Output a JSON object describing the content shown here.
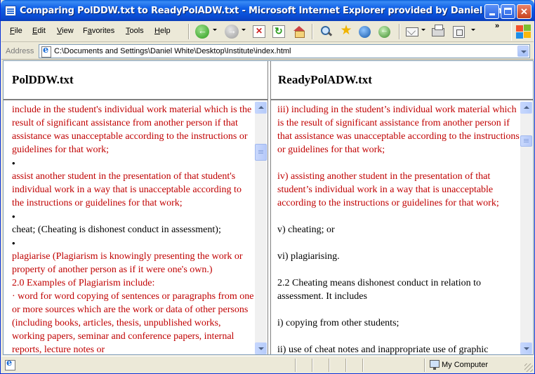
{
  "window": {
    "title": "Comparing PolDDW.txt to ReadyPolADW.txt - Microsoft Internet Explorer provided by Daniel White"
  },
  "menu": {
    "items": [
      {
        "label": "File",
        "key": "F"
      },
      {
        "label": "Edit",
        "key": "E"
      },
      {
        "label": "View",
        "key": "V"
      },
      {
        "label": "Favorites",
        "key": "a"
      },
      {
        "label": "Tools",
        "key": "T"
      },
      {
        "label": "Help",
        "key": "H"
      }
    ]
  },
  "toolbar": {
    "icons": [
      "back-icon",
      "forward-icon",
      "stop-icon",
      "refresh-icon",
      "home-icon",
      "search-icon",
      "favorites-icon",
      "media-icon",
      "history-icon",
      "mail-icon",
      "print-icon",
      "edit-icon"
    ],
    "overflow": "»"
  },
  "address": {
    "label": "Address",
    "value": "C:\\Documents and Settings\\Daniel White\\Desktop\\Institute\\index.html"
  },
  "left_frame": {
    "title": "PolDDW.txt",
    "lines": [
      {
        "text": "include in the student's individual work material which is the result of significant assistance from another person if that assistance was unacceptable according to the instructions or guidelines for that work;",
        "color": "red"
      },
      {
        "text": "•",
        "color": "black",
        "bullet": true
      },
      {
        "text": "assist another student in the presentation of that student's individual work in a way that is unacceptable according to the instructions or guidelines for that work;",
        "color": "red"
      },
      {
        "text": "•",
        "color": "black",
        "bullet": true
      },
      {
        "text": "cheat; (Cheating is dishonest conduct in assessment);",
        "color": "black"
      },
      {
        "text": "•",
        "color": "black",
        "bullet": true
      },
      {
        "text": "plagiarise (Plagiarism is knowingly presenting the work or property of another person as if it were one's own.)",
        "color": "red"
      },
      {
        "text": "2.0 Examples of Plagiarism include:",
        "color": "red"
      },
      {
        "text": "· word for word copying of sentences or paragraphs from one or more sources which are the work or data of other persons (including books, articles, thesis, unpublished works, working papers, seminar and conference papers, internal reports, lecture notes or",
        "color": "red"
      }
    ]
  },
  "right_frame": {
    "title": "ReadyPolADW.txt",
    "lines": [
      {
        "text": "iii) including in the student’s individual work material which is the result of significant assistance from another person if that assistance was unacceptable according to the instructions or guidelines for that work;",
        "color": "red"
      },
      {
        "text": "",
        "color": "black",
        "gap": true
      },
      {
        "text": "iv) assisting another student in the presentation of that student’s individual work in a way that is unacceptable according to the instructions or guidelines for that work;",
        "color": "red"
      },
      {
        "text": "",
        "color": "black",
        "gap": true
      },
      {
        "text": "v) cheating; or",
        "color": "black"
      },
      {
        "text": "",
        "color": "black",
        "gap": true
      },
      {
        "text": "vi) plagiarising.",
        "color": "black"
      },
      {
        "text": "",
        "color": "black",
        "gap": true
      },
      {
        "text": "2.2 Cheating means dishonest conduct in relation to assessment. It includes",
        "color": "black"
      },
      {
        "text": "",
        "color": "black",
        "gap": true
      },
      {
        "text": "i) copying from other students;",
        "color": "black"
      },
      {
        "text": "",
        "color": "black",
        "gap": true
      },
      {
        "text": "ii) use of cheat notes and inappropriate use of graphic",
        "color": "black"
      }
    ]
  },
  "status": {
    "zone": "My Computer"
  },
  "colors": {
    "diff_red": "#c00000",
    "title_bar": "#0a5fd9"
  }
}
